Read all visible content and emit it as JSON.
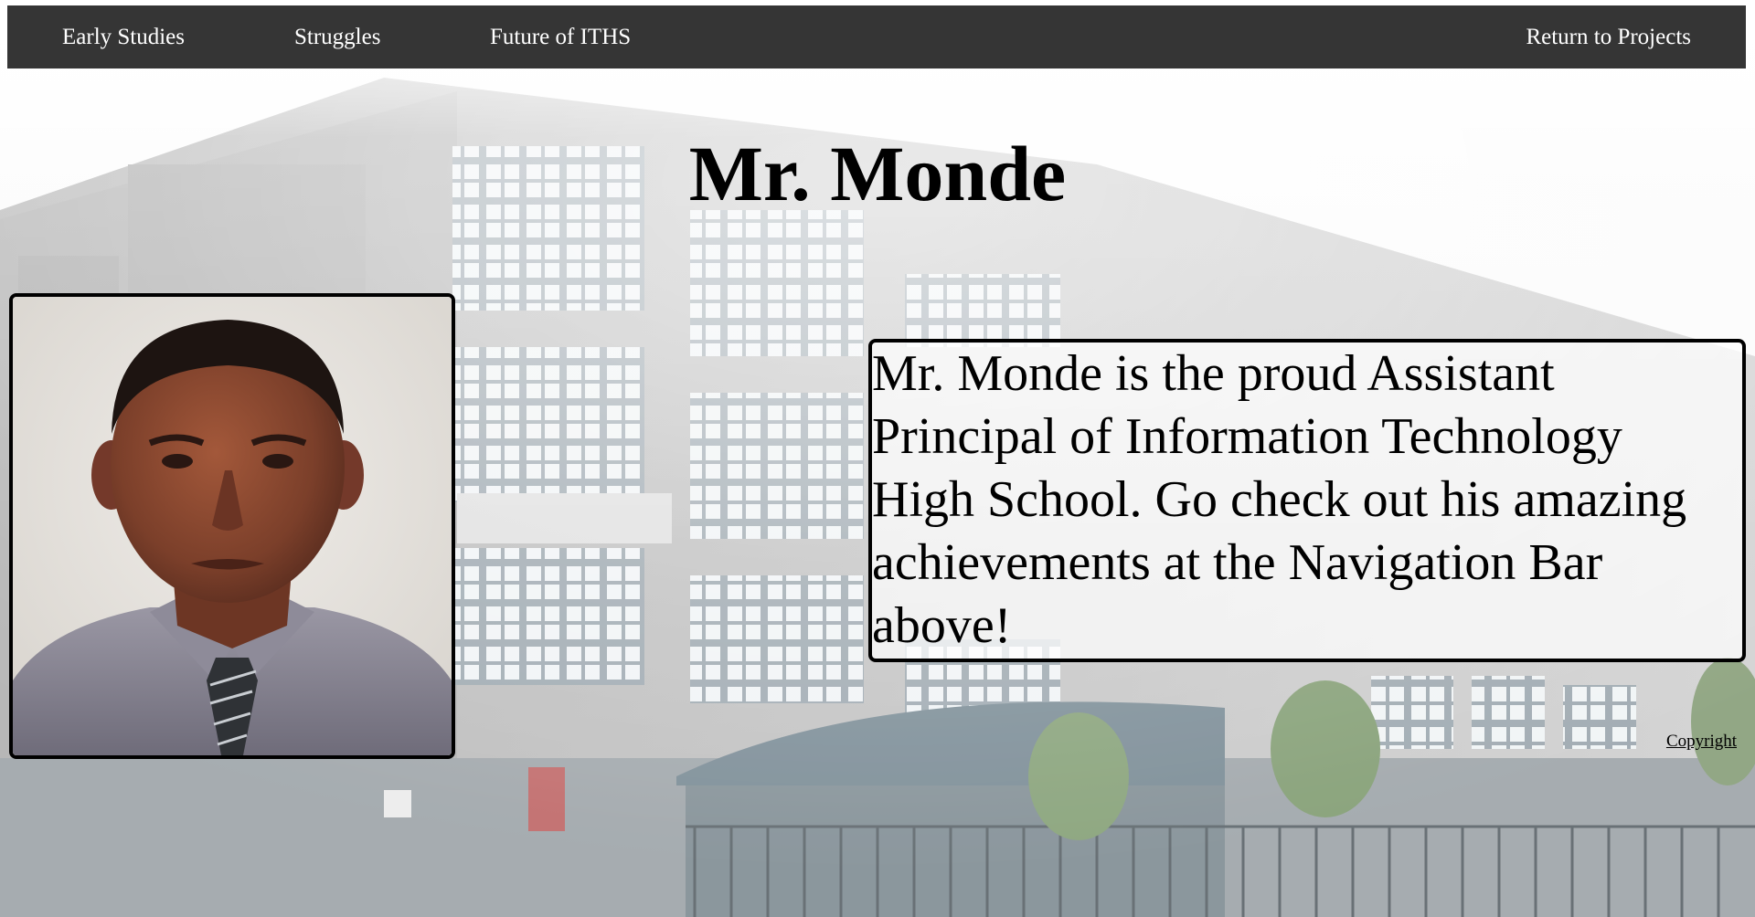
{
  "nav": {
    "items": [
      {
        "label": "Early Studies"
      },
      {
        "label": "Struggles"
      },
      {
        "label": "Future of ITHS"
      }
    ],
    "return_label": "Return to Projects"
  },
  "page": {
    "title": "Mr. Monde",
    "description": "Mr. Monde is the proud Assistant Principal of Information Technology High School. Go check out his amazing achievements at the Navigation Bar above!",
    "copyright_label": "Copyright"
  },
  "colors": {
    "navbar_bg": "#353535",
    "nav_text": "#ffffff",
    "border": "#000000"
  }
}
